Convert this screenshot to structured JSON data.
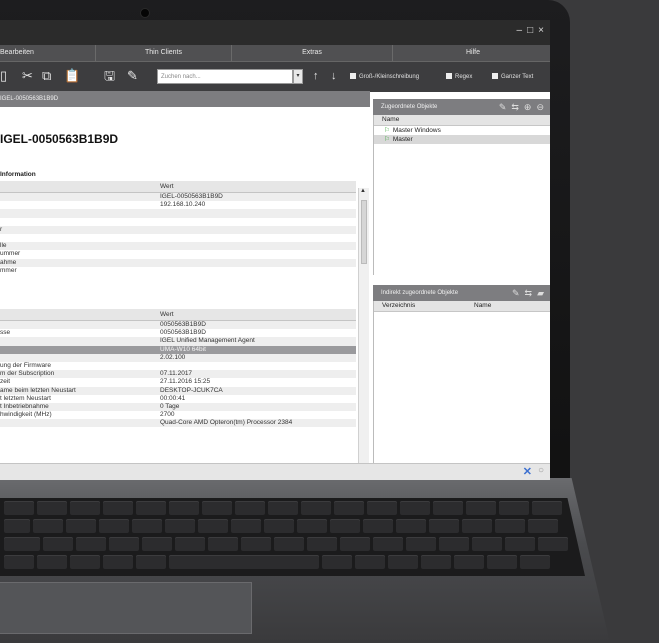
{
  "menu": [
    "Bearbeiten",
    "Thin Clients",
    "Extras",
    "Hilfe"
  ],
  "window_controls": [
    "–",
    "□",
    "×"
  ],
  "toolbar": {
    "search_placeholder": "Zuchen nach...",
    "search_dropdown": "▾",
    "up_arrow": "↑",
    "down_arrow": "↓",
    "case_sensitive": "Groß-/Kleinschreibung",
    "regex": "Regex",
    "whole_text": "Ganzer Text",
    "icons": [
      "cut-icon",
      "copy-icon",
      "paste-icon",
      "save-icon",
      "tools-icon"
    ]
  },
  "left_pane": {
    "header": "IGEL-0050563B1B9D",
    "device_title": "IGEL-0050563B1B9D",
    "section_title": "Information",
    "table1": {
      "value_header": "Wert",
      "rows": [
        {
          "label": "",
          "value": "IGEL-0050563B1B9D"
        },
        {
          "label": "",
          "value": "192.168.10.240"
        },
        {
          "label": "",
          "value": ""
        },
        {
          "label": "",
          "value": ""
        },
        {
          "label": "r",
          "value": ""
        },
        {
          "label": "",
          "value": ""
        },
        {
          "label": "lle",
          "value": ""
        },
        {
          "label": "ummer",
          "value": ""
        },
        {
          "label": "ahme",
          "value": ""
        },
        {
          "label": "mmer",
          "value": ""
        }
      ]
    },
    "table2": {
      "value_header": "Wert",
      "rows": [
        {
          "label": "",
          "value": "0050563B1B9D"
        },
        {
          "label": "sse",
          "value": "0050563B1B9D"
        },
        {
          "label": "",
          "value": "IGEL Unified Management Agent"
        },
        {
          "label": "",
          "value": "UMA-W10 64bit",
          "selected": true
        },
        {
          "label": "",
          "value": "2.02.100"
        },
        {
          "label": "ung der Firmware",
          "value": ""
        },
        {
          "label": "m der Subscription",
          "value": "07.11.2017"
        },
        {
          "label": "zeit",
          "value": "27.11.2016 15:25"
        },
        {
          "label": "ame beim letzten Neustart",
          "value": "DESKTOP-JCUK7CA"
        },
        {
          "label": "t letztem Neustart",
          "value": "00:00:41"
        },
        {
          "label": "t Inbetriebnahme",
          "value": "0 Tage"
        },
        {
          "label": "hwindigkeit (MHz)",
          "value": "2700"
        },
        {
          "label": "",
          "value": "Quad-Core AMD Opteron(tm) Processor 2384"
        }
      ]
    }
  },
  "right_top": {
    "header": "Zugeordnete Objekte",
    "column": "Name",
    "items": [
      "Master Windows",
      "Master"
    ]
  },
  "right_bottom": {
    "header": "Indirekt zugeordnete Objekte",
    "columns": [
      "Verzeichnis",
      "Name"
    ]
  }
}
